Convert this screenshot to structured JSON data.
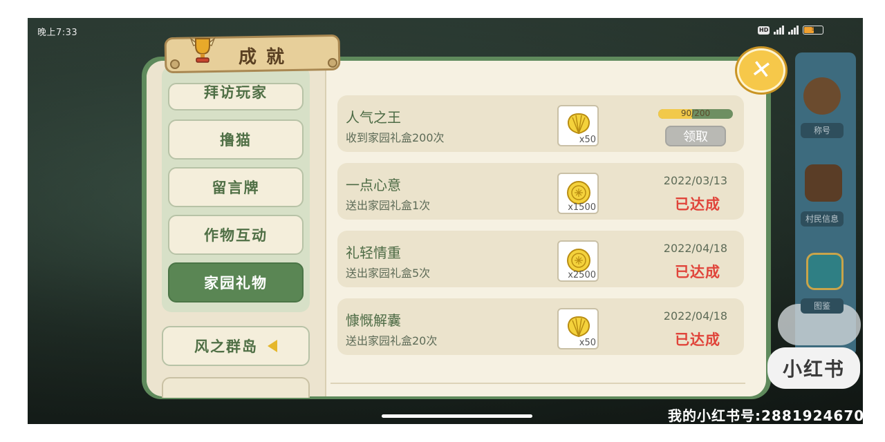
{
  "status_bar": {
    "time": "晚上7:33",
    "hd": "HD",
    "battery_level": "5"
  },
  "background": {
    "labels": [
      "称号",
      "村民信息",
      "图鉴"
    ],
    "bg_battery": "45%"
  },
  "dialog": {
    "title": "成就",
    "close_label": "✕"
  },
  "sidebar": {
    "items": [
      {
        "label": "拜访玩家",
        "active": false
      },
      {
        "label": "撸猫",
        "active": false
      },
      {
        "label": "留言牌",
        "active": false
      },
      {
        "label": "作物互动",
        "active": false
      },
      {
        "label": "家园礼物",
        "active": true
      }
    ],
    "island": {
      "label": "风之群岛"
    }
  },
  "achievements": [
    {
      "title": "人气之王",
      "desc": "收到家园礼盒200次",
      "reward_qty": "x50",
      "reward_icon": "shell-icon",
      "progress": "90/200",
      "progress_fraction": 0.45,
      "claim_label": "领取"
    },
    {
      "title": "一点心意",
      "desc": "送出家园礼盒1次",
      "reward_qty": "x1500",
      "reward_icon": "coin-icon",
      "date": "2022/03/13",
      "status": "已达成"
    },
    {
      "title": "礼轻情重",
      "desc": "送出家园礼盒5次",
      "reward_qty": "x2500",
      "reward_icon": "coin-icon",
      "date": "2022/04/18",
      "status": "已达成"
    },
    {
      "title": "慷慨解囊",
      "desc": "送出家园礼盒20次",
      "reward_qty": "x50",
      "reward_icon": "shell-icon",
      "date": "2022/04/18",
      "status": "已达成"
    }
  ],
  "watermark": {
    "logo": "小红书",
    "id_text": "我的小红书号:2881924670"
  },
  "colors": {
    "accent_green": "#5a8654",
    "status_red": "#e0443a",
    "progress_yellow": "#f2c94a"
  }
}
